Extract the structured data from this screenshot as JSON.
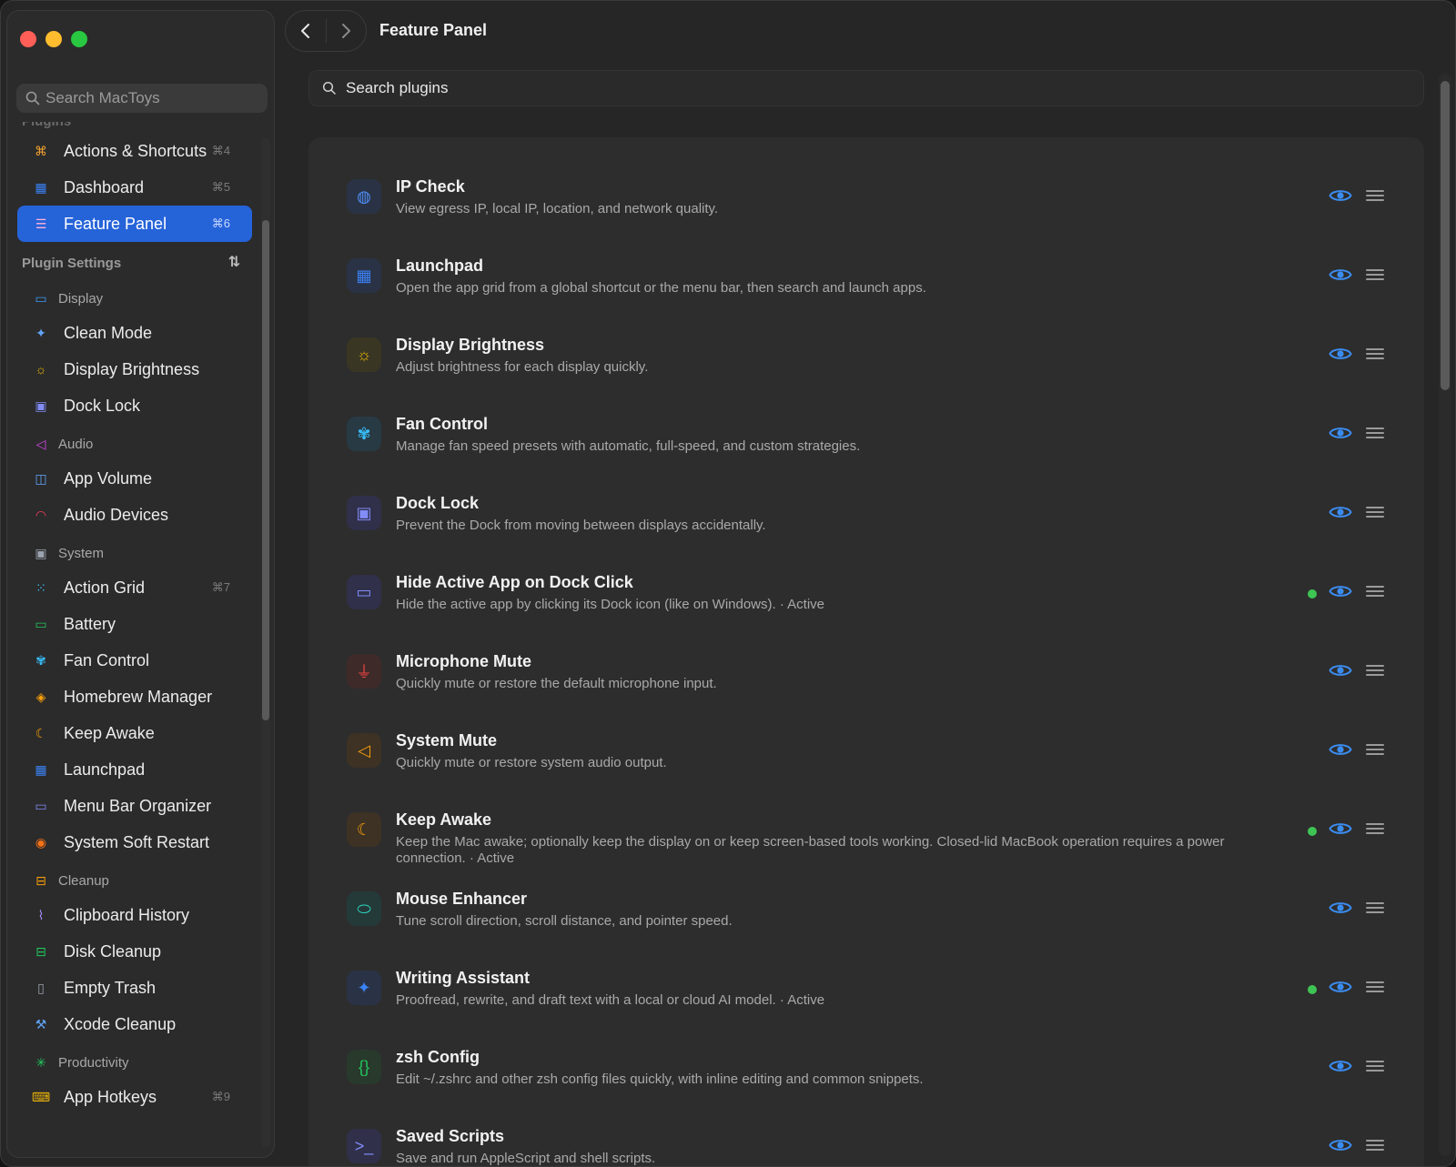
{
  "app": {
    "sidebar_search_placeholder": "Search MacToys",
    "page_title": "Feature Panel",
    "main_search_placeholder": "Search plugins"
  },
  "sidebar": {
    "plugins_header": "Plugins",
    "plugin_items": [
      {
        "label": "Actions & Shortcuts",
        "shortcut": "⌘4",
        "icon": "command-icon",
        "color": "#f0a030"
      },
      {
        "label": "Dashboard",
        "shortcut": "⌘5",
        "icon": "grid-icon",
        "color": "#3b82f6"
      },
      {
        "label": "Feature Panel",
        "shortcut": "⌘6",
        "icon": "toggles-icon",
        "color": "#f472b6"
      }
    ],
    "settings_header": "Plugin Settings",
    "groups": [
      {
        "name": "Display",
        "icon": "monitor-icon",
        "color": "#3b9cf6",
        "items": [
          {
            "label": "Clean Mode",
            "shortcut": "",
            "icon": "sparkle-icon",
            "color": "#60a5fa"
          },
          {
            "label": "Display Brightness",
            "shortcut": "",
            "icon": "sun-icon",
            "color": "#eab308"
          },
          {
            "label": "Dock Lock",
            "shortcut": "",
            "icon": "lock-icon",
            "color": "#818cf8"
          }
        ]
      },
      {
        "name": "Audio",
        "icon": "speaker-icon",
        "color": "#d946ef",
        "items": [
          {
            "label": "App Volume",
            "shortcut": "",
            "icon": "app-volume-icon",
            "color": "#60a5fa"
          },
          {
            "label": "Audio Devices",
            "shortcut": "",
            "icon": "headphones-icon",
            "color": "#f43f5e"
          }
        ]
      },
      {
        "name": "System",
        "icon": "chip-icon",
        "color": "#9ca3af",
        "items": [
          {
            "label": "Action Grid",
            "shortcut": "⌘7",
            "icon": "dots-grid-icon",
            "color": "#38bdf8"
          },
          {
            "label": "Battery",
            "shortcut": "",
            "icon": "battery-icon",
            "color": "#22c55e"
          },
          {
            "label": "Fan Control",
            "shortcut": "",
            "icon": "fan-icon",
            "color": "#38bdf8"
          },
          {
            "label": "Homebrew Manager",
            "shortcut": "",
            "icon": "box-icon",
            "color": "#f59e0b"
          },
          {
            "label": "Keep Awake",
            "shortcut": "",
            "icon": "moon-icon",
            "color": "#f59e0b"
          },
          {
            "label": "Launchpad",
            "shortcut": "",
            "icon": "apps-icon",
            "color": "#3b82f6"
          },
          {
            "label": "Menu Bar Organizer",
            "shortcut": "",
            "icon": "menubar-icon",
            "color": "#818cf8"
          },
          {
            "label": "System Soft Restart",
            "shortcut": "",
            "icon": "restart-icon",
            "color": "#f97316"
          }
        ]
      },
      {
        "name": "Cleanup",
        "icon": "tray-icon",
        "color": "#f59e0b",
        "items": [
          {
            "label": "Clipboard History",
            "shortcut": "",
            "icon": "clip-icon",
            "color": "#a78bfa"
          },
          {
            "label": "Disk Cleanup",
            "shortcut": "",
            "icon": "disk-icon",
            "color": "#22c55e"
          },
          {
            "label": "Empty Trash",
            "shortcut": "",
            "icon": "trash-icon",
            "color": "#9ca3af"
          },
          {
            "label": "Xcode Cleanup",
            "shortcut": "",
            "icon": "hammer-icon",
            "color": "#60a5fa"
          }
        ]
      },
      {
        "name": "Productivity",
        "icon": "burst-icon",
        "color": "#22c55e",
        "items": [
          {
            "label": "App Hotkeys",
            "shortcut": "⌘9",
            "icon": "keyboard-icon",
            "color": "#eab308"
          }
        ]
      }
    ]
  },
  "plugins": [
    {
      "title": "IP Check",
      "desc": "View egress IP, local IP, location, and network quality.",
      "active": false,
      "icon": "globe-icon",
      "glyph": "◍",
      "color": "#4f8ff7",
      "bg": "#2a3346"
    },
    {
      "title": "Launchpad",
      "desc": "Open the app grid from a global shortcut or the menu bar, then search and launch apps.",
      "active": false,
      "icon": "apps-icon",
      "glyph": "▦",
      "color": "#3b82f6",
      "bg": "#2a3346"
    },
    {
      "title": "Display Brightness",
      "desc": "Adjust brightness for each display quickly.",
      "active": false,
      "icon": "sun-icon",
      "glyph": "☼",
      "color": "#eab308",
      "bg": "#3a3624"
    },
    {
      "title": "Fan Control",
      "desc": "Manage fan speed presets with automatic, full-speed, and custom strategies.",
      "active": false,
      "icon": "fan-icon",
      "glyph": "✾",
      "color": "#38bdf8",
      "bg": "#283a44"
    },
    {
      "title": "Dock Lock",
      "desc": "Prevent the Dock from moving between displays accidentally.",
      "active": false,
      "icon": "lock-icon",
      "glyph": "▣",
      "color": "#818cf8",
      "bg": "#30304a"
    },
    {
      "title": "Hide Active App on Dock Click",
      "desc": "Hide the active app by clicking its Dock icon (like on Windows). · Active",
      "active": true,
      "icon": "dock-icon",
      "glyph": "▭",
      "color": "#818cf8",
      "bg": "#30304a"
    },
    {
      "title": "Microphone Mute",
      "desc": "Quickly mute or restore the default microphone input.",
      "active": false,
      "icon": "mic-off-icon",
      "glyph": "⏚",
      "color": "#ef4444",
      "bg": "#3f2a2a"
    },
    {
      "title": "System Mute",
      "desc": "Quickly mute or restore system audio output.",
      "active": false,
      "icon": "speaker-off-icon",
      "glyph": "◁",
      "color": "#f59e0b",
      "bg": "#3d3224"
    },
    {
      "title": "Keep Awake",
      "desc": "Keep the Mac awake; optionally keep the display on or keep screen-based tools working. Closed-lid MacBook operation requires a power connection. · Active",
      "active": true,
      "icon": "moon-icon",
      "glyph": "☾",
      "color": "#f59e0b",
      "bg": "#3d3224"
    },
    {
      "title": "Mouse Enhancer",
      "desc": "Tune scroll direction, scroll distance, and pointer speed.",
      "active": false,
      "icon": "mouse-icon",
      "glyph": "⬭",
      "color": "#2dd4bf",
      "bg": "#243a38"
    },
    {
      "title": "Writing Assistant",
      "desc": "Proofread, rewrite, and draft text with a local or cloud AI model. · Active",
      "active": true,
      "icon": "sparkle-icon",
      "glyph": "✦",
      "color": "#3b82f6",
      "bg": "#2a3346"
    },
    {
      "title": "zsh Config",
      "desc": "Edit ~/.zshrc and other zsh config files quickly, with inline editing and common snippets.",
      "active": false,
      "icon": "braces-icon",
      "glyph": "{}",
      "color": "#22c55e",
      "bg": "#283a2c"
    },
    {
      "title": "Saved Scripts",
      "desc": "Save and run AppleScript and shell scripts.",
      "active": false,
      "icon": "terminal-icon",
      "glyph": ">_",
      "color": "#818cf8",
      "bg": "#30304a"
    }
  ],
  "colors": {
    "accent": "#2563d9",
    "eye": "#3b8cf0",
    "active_dot": "#3ec454"
  }
}
